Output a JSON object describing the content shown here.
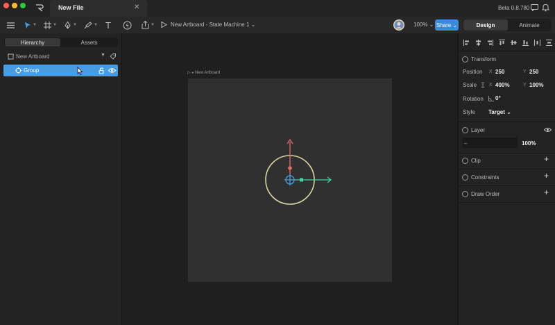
{
  "window": {
    "tab_title": "New File",
    "tab_close": "✕",
    "version": "Beta 0.8.780"
  },
  "toolbar": {
    "state_machine_label": "New Artboard - State Machine 1 ⌄",
    "zoom": "100% ⌄",
    "share_label": "Share ⌄",
    "design_label": "Design",
    "animate_label": "Animate",
    "text_tool_glyph": "T"
  },
  "left_panel": {
    "tabs": [
      "Hierarchy",
      "Assets"
    ],
    "artboard_item": "New Artboard",
    "group_item": "Group"
  },
  "canvas": {
    "artboard_label": "New Artboard"
  },
  "right_panel": {
    "transform_title": "Transform",
    "position_label": "Position",
    "position_x_axis": "X",
    "position_x": "250",
    "position_y_axis": "Y",
    "position_y": "250",
    "scale_label": "Scale",
    "scale_x_axis": "X",
    "scale_x": "400%",
    "scale_y_axis": "Y",
    "scale_y": "100%",
    "rotation_label": "Rotation",
    "rotation_value": "0°",
    "style_label": "Style",
    "style_value": "Target ⌄",
    "layer_title": "Layer",
    "layer_blend": "–",
    "layer_opacity": "100%",
    "clip_title": "Clip",
    "constraints_title": "Constraints",
    "draw_order_title": "Draw Order"
  },
  "colors": {
    "accent": "#4a9ce0",
    "share": "#3b8ad9",
    "gizmo_x": "#3fd4a0",
    "gizmo_y": "#e06b6b",
    "circle": "#d9d3a0"
  }
}
